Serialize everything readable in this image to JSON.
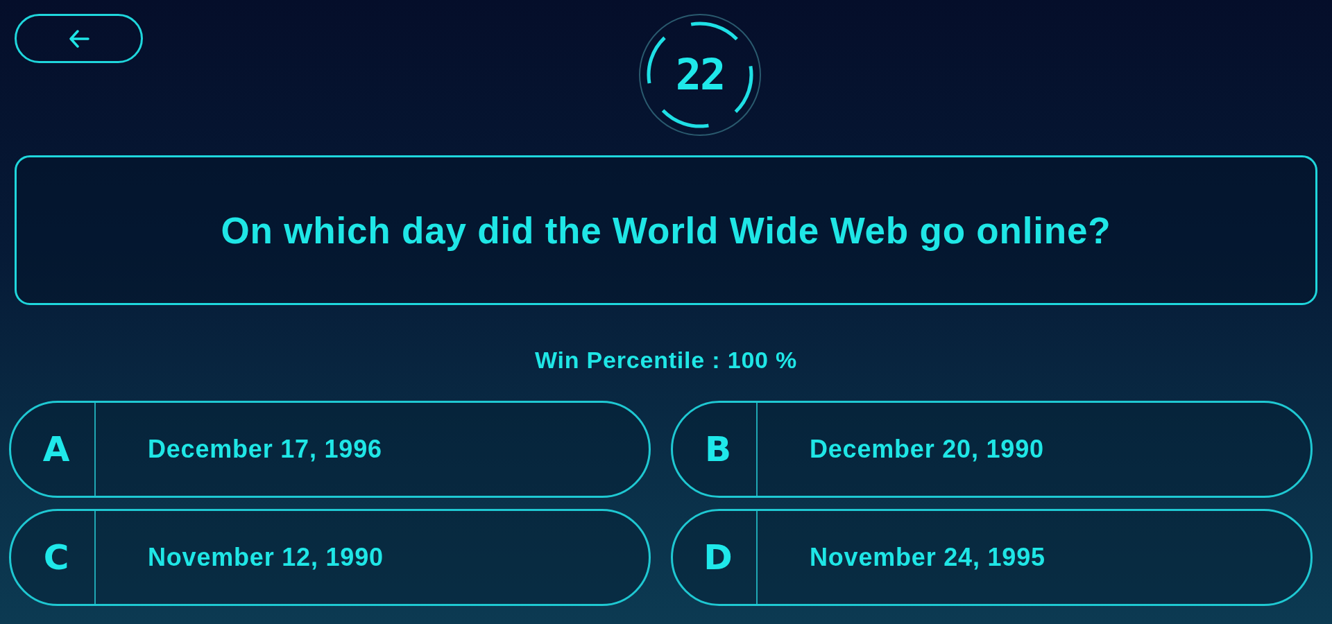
{
  "timer": {
    "value": "22"
  },
  "question": {
    "text": "On which day did the World Wide Web go online?"
  },
  "stats": {
    "text": "Win Percentile : 100 %"
  },
  "answers": [
    {
      "letter": "A",
      "text": "December 17, 1996",
      "selected": false
    },
    {
      "letter": "B",
      "text": "December 20, 1990",
      "selected": false
    },
    {
      "letter": "C",
      "text": "November 12, 1990",
      "selected": false
    },
    {
      "letter": "D",
      "text": "November 24, 1995",
      "selected": false
    }
  ]
}
